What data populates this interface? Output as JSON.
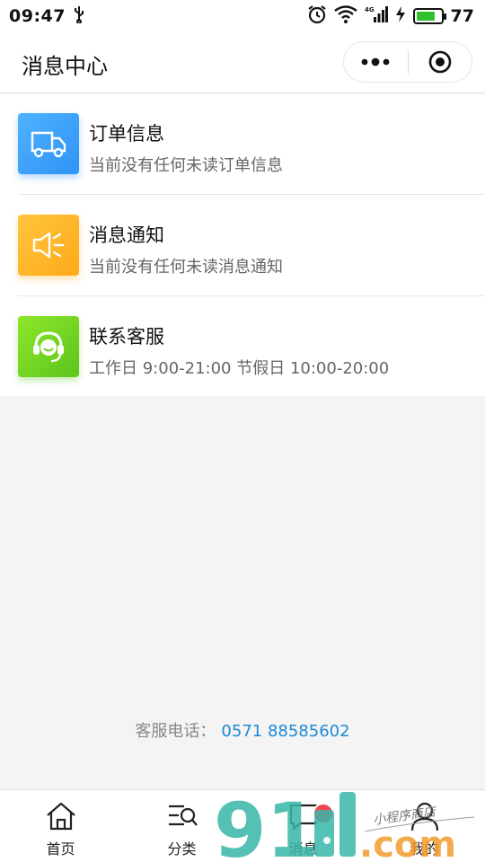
{
  "status_bar": {
    "time": "09:47",
    "battery_level": "77",
    "battery_fraction": 0.77,
    "network_label": "4G"
  },
  "nav": {
    "title": "消息中心"
  },
  "messages": [
    {
      "title": "订单信息",
      "subtitle": "当前没有任何未读订单信息",
      "icon": "truck-icon",
      "color": "#3aa0fb"
    },
    {
      "title": "消息通知",
      "subtitle": "当前没有任何未读消息通知",
      "icon": "speaker-icon",
      "color": "#ffb42a"
    },
    {
      "title": "联系客服",
      "subtitle": "工作日 9:00-21:00 节假日 10:00-20:00",
      "icon": "headset-icon",
      "color": "#72d622"
    }
  ],
  "service": {
    "label": "客服电话：",
    "phone": "0571 88585602"
  },
  "tabs": [
    {
      "label": "首页",
      "icon": "home-icon"
    },
    {
      "label": "分类",
      "icon": "category-search-icon"
    },
    {
      "label": "消息",
      "icon": "message-icon"
    },
    {
      "label": "我的",
      "icon": "user-icon"
    }
  ],
  "watermark": {
    "brand": "91",
    "suffix": ".com",
    "tagline": "小程序商店"
  },
  "colors": {
    "accent_blue": "#1c8ad4",
    "badge_red": "#f2454e",
    "watermark_teal": "#38b6a8",
    "watermark_orange": "#f39c2b"
  }
}
